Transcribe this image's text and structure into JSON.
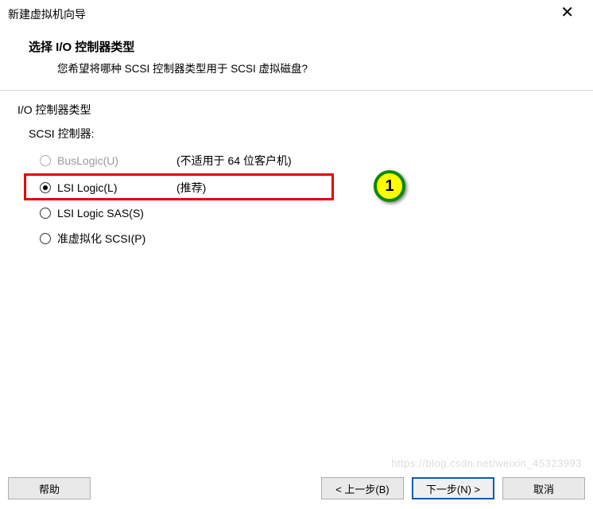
{
  "window": {
    "title": "新建虚拟机向导"
  },
  "header": {
    "title": "选择 I/O 控制器类型",
    "subtitle": "您希望将哪种 SCSI 控制器类型用于 SCSI 虚拟磁盘?"
  },
  "group": {
    "label": "I/O 控制器类型",
    "controller_label": "SCSI 控制器:"
  },
  "options": {
    "buslogic": {
      "label": "BusLogic(U)",
      "note": "(不适用于 64 位客户机)"
    },
    "lsilogic": {
      "label": "LSI Logic(L)",
      "note": "(推荐)"
    },
    "lsisas": {
      "label": "LSI Logic SAS(S)"
    },
    "pvscsi": {
      "label": "准虚拟化 SCSI(P)"
    }
  },
  "annotation": {
    "badge": "1"
  },
  "buttons": {
    "help": "帮助",
    "back": "< 上一步(B)",
    "next": "下一步(N) >",
    "cancel": "取消"
  },
  "watermark": "https://blog.csdn.net/weixin_45323993"
}
